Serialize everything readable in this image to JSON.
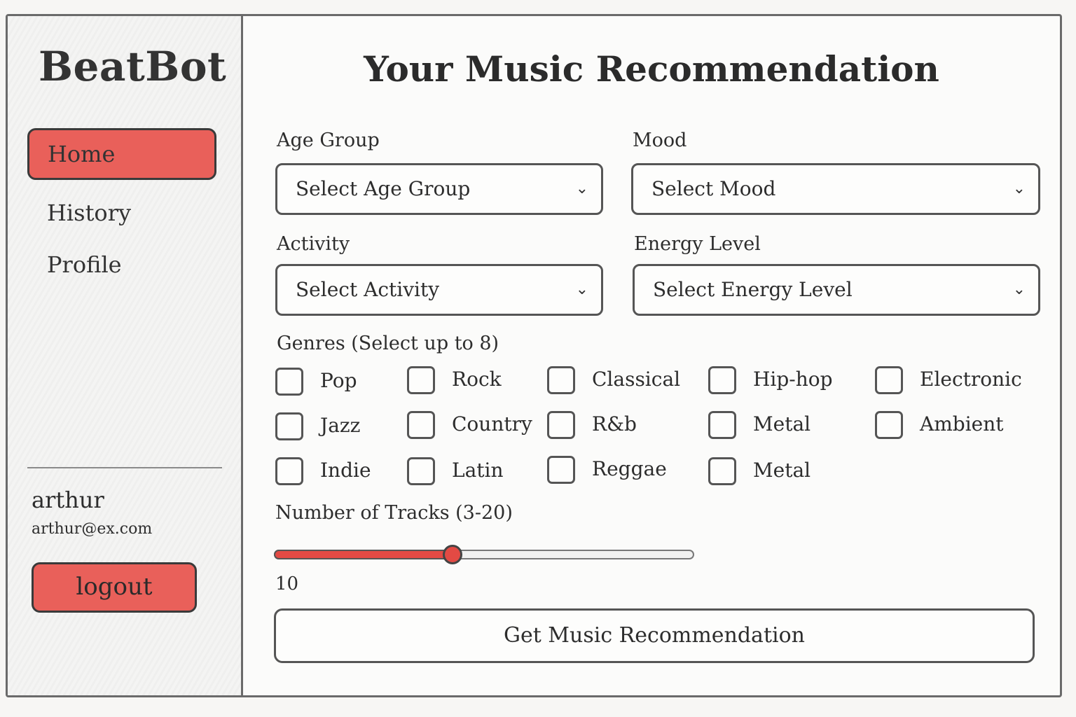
{
  "sidebar": {
    "brand": "BeatBot",
    "nav": [
      {
        "label": "Home",
        "active": true
      },
      {
        "label": "History",
        "active": false
      },
      {
        "label": "Profile",
        "active": false
      }
    ],
    "user": {
      "name": "arthur",
      "email": "arthur@ex.com"
    },
    "logout_label": "logout"
  },
  "main": {
    "title": "Your Music Recommendation",
    "age_group": {
      "label": "Age Group",
      "value": "Select Age Group"
    },
    "mood": {
      "label": "Mood",
      "value": "Select Mood"
    },
    "activity": {
      "label": "Activity",
      "value": "Select Activity"
    },
    "energy": {
      "label": "Energy Level",
      "value": "Select Energy Level"
    },
    "genres_label": "Genres (Select up to 8)",
    "genres": [
      "Pop",
      "Rock",
      "Classical",
      "Hip-hop",
      "Electronic",
      "Jazz",
      "Country",
      "R&b",
      "Metal",
      "Ambient",
      "Indie",
      "Latin",
      "Reggae",
      "Metal"
    ],
    "tracks": {
      "label": "Number of Tracks (3-20)",
      "value": "10",
      "min": 3,
      "max": 20,
      "current": 10
    },
    "submit_label": "Get Music Recommendation"
  },
  "colors": {
    "accent": "#e9605a"
  },
  "icons": {
    "select_chevron": "chevron-down-icon"
  }
}
